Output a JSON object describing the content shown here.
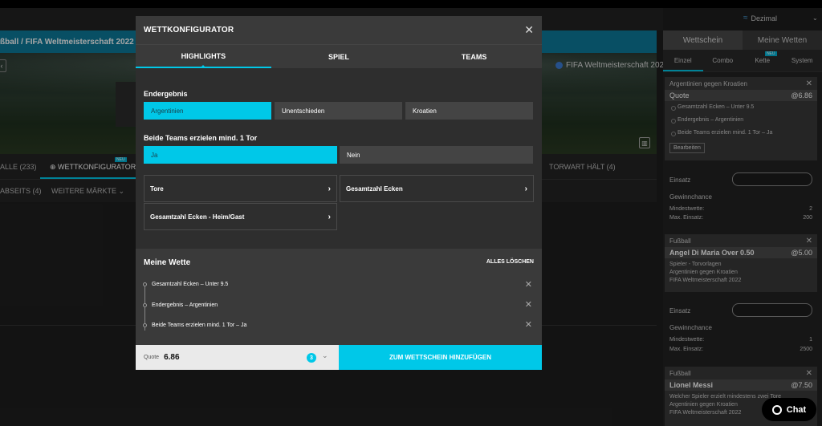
{
  "background": {
    "breadcrumb": "ßball / FIFA Weltmeisterschaft 2022",
    "back_glyph": "‹",
    "event_label": "FIFA Weltmeisterschaft 2022",
    "stats_glyph": "▥",
    "tabs_row1": [
      {
        "label": "ALLE (233)"
      },
      {
        "label": "⊕  WETTKONFIGURATOR"
      },
      {
        "label": "TORWART HÄLT (4)"
      }
    ],
    "new_badge": "NEU",
    "tabs_row2": [
      {
        "label": "ABSEITS (4)"
      },
      {
        "label": "WEITERE MÄRKTE ⌄"
      }
    ]
  },
  "odds_format": {
    "icon": "≈",
    "label": "Dezimal",
    "chevron": "⌄"
  },
  "betslip": {
    "tabs": [
      "Wettschein",
      "Meine Wetten"
    ],
    "subtabs": [
      "Einzel",
      "Combo",
      "Kette",
      "System"
    ],
    "subtab_badge": "NEU",
    "card1": {
      "header": "Argentinien gegen Kroatien",
      "quote_label": "Quote",
      "quote_value": "@6.86",
      "selections": [
        "Gesamtzahl Ecken – Unter 9.5",
        "Endergebnis – Argentinien",
        "Beide Teams erzielen mind. 1 Tor – Ja"
      ],
      "edit_button": "Bearbeiten"
    },
    "stake1": {
      "label": "Einsatz",
      "chance": "Gewinnchance",
      "min_label": "Mindestwette:",
      "min_value": "2",
      "max_label": "Max. Einsatz:",
      "max_value": "200"
    },
    "card2": {
      "header": "Fußball",
      "title": "Angel Di Maria Over  0.50",
      "odds": "@5.00",
      "lines": [
        "Spieler - Torvorlagen",
        "Argentinien gegen Kroatien",
        "FIFA Weltmeisterschaft 2022"
      ]
    },
    "stake2": {
      "label": "Einsatz",
      "chance": "Gewinnchance",
      "min_label": "Mindestwette:",
      "min_value": "1",
      "max_label": "Max. Einsatz:",
      "max_value": "2500"
    },
    "card3": {
      "header": "Fußball",
      "title": "Lionel Messi",
      "odds": "@7.50",
      "lines": [
        "Welcher Spieler erzielt mindestens zwei Tore",
        "Argentinien gegen Kroatien",
        "FIFA Weltmeisterschaft 2022"
      ]
    },
    "close_glyph": "✕"
  },
  "chat": {
    "label": "Chat"
  },
  "modal": {
    "title": "WETTKONFIGURATOR",
    "close_glyph": "✕",
    "tabs": [
      "HIGHLIGHTS",
      "SPIEL",
      "TEAMS"
    ],
    "market1": {
      "label": "Endergebnis",
      "options": [
        "Argentinien",
        "Unentschieden",
        "Kroatien"
      ]
    },
    "market2": {
      "label": "Beide Teams erzielen mind. 1 Tor",
      "options": [
        "Ja",
        "Nein"
      ]
    },
    "expanders": [
      "Tore",
      "Gesamtzahl Ecken",
      "Gesamtzahl Ecken - Heim/Gast"
    ],
    "expander_arrow": "›",
    "my_bet": {
      "title": "Meine Wette",
      "clear_all": "ALLES LÖSCHEN",
      "legs": [
        "Gesamtzahl Ecken – Unter 9.5",
        "Endergebnis – Argentinien",
        "Beide Teams erzielen mind. 1 Tor – Ja"
      ],
      "remove_glyph": "✕"
    },
    "footer": {
      "quote_label": "Quote",
      "quote_value": "6.86",
      "count": "3",
      "chevron": "⌄",
      "add_button": "ZUM WETTSCHEIN HINZUFÜGEN"
    }
  },
  "colors": {
    "accent": "#00c8e8",
    "background": "#1e1e1e",
    "modal": "#2e2e2e"
  }
}
